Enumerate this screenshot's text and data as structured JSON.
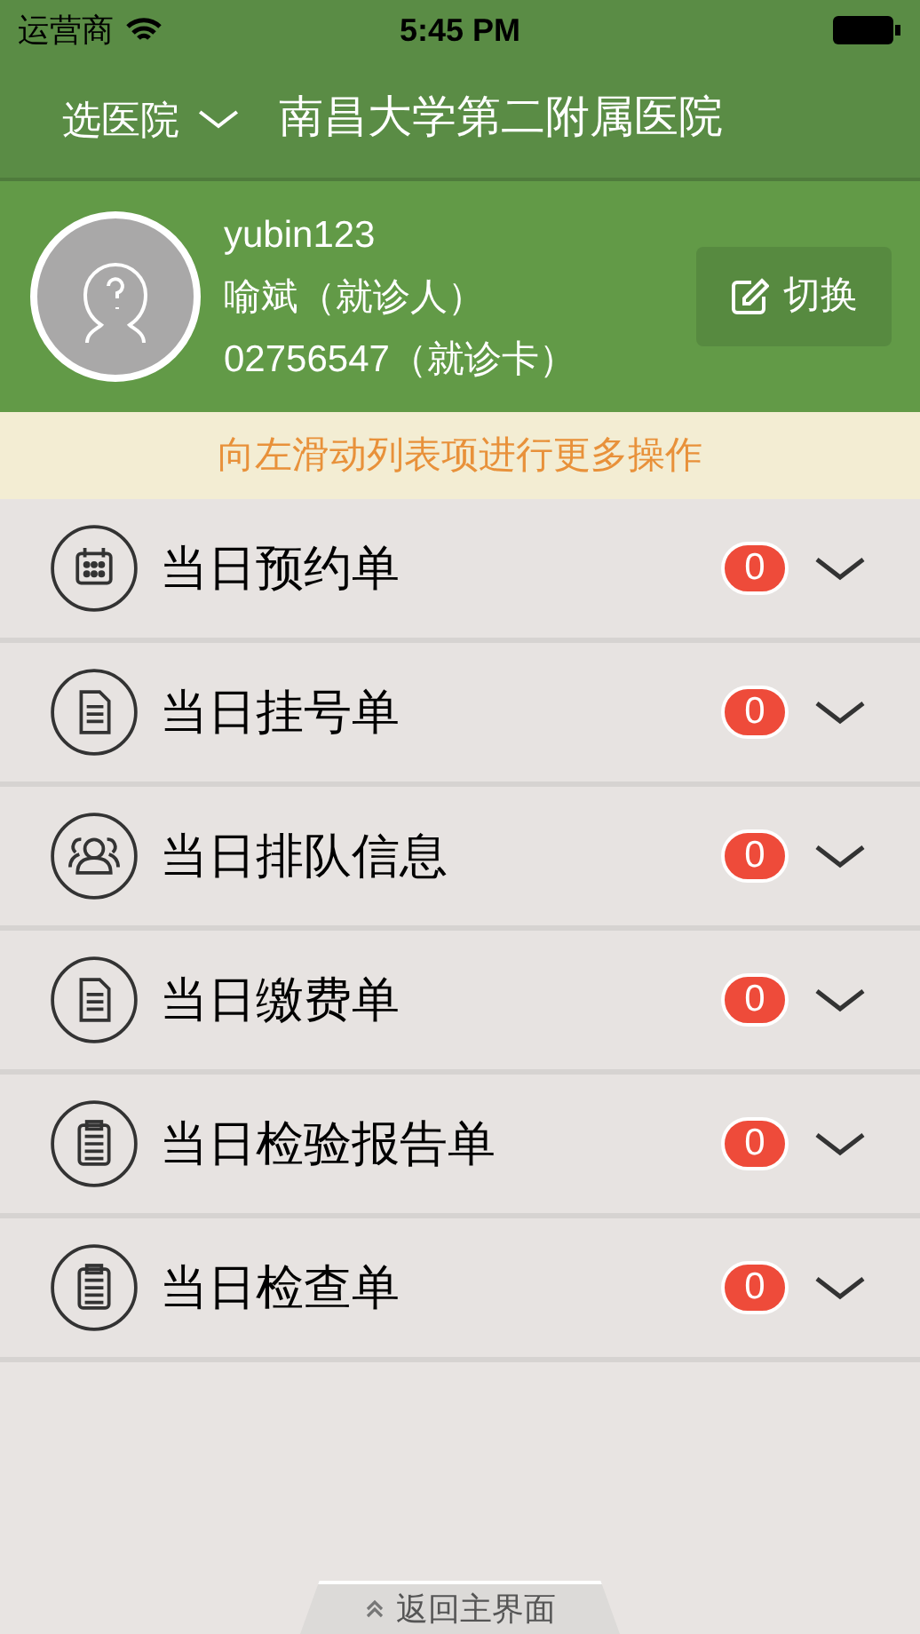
{
  "status_bar": {
    "carrier": "运营商",
    "time": "5:45 PM"
  },
  "header": {
    "picker": "选医院",
    "title": "南昌大学第二附属医院"
  },
  "profile": {
    "username": "yubin123",
    "patient": "喻斌（就诊人）",
    "card": "02756547（就诊卡）",
    "switch_button": "切换"
  },
  "notice": "向左滑动列表项进行更多操作",
  "items": [
    {
      "label": "当日预约单",
      "count": "0"
    },
    {
      "label": "当日挂号单",
      "count": "0"
    },
    {
      "label": "当日排队信息",
      "count": "0"
    },
    {
      "label": "当日缴费单",
      "count": "0"
    },
    {
      "label": "当日检验报告单",
      "count": "0"
    },
    {
      "label": "当日检查单",
      "count": "0"
    }
  ],
  "back_button": "返回主界面"
}
